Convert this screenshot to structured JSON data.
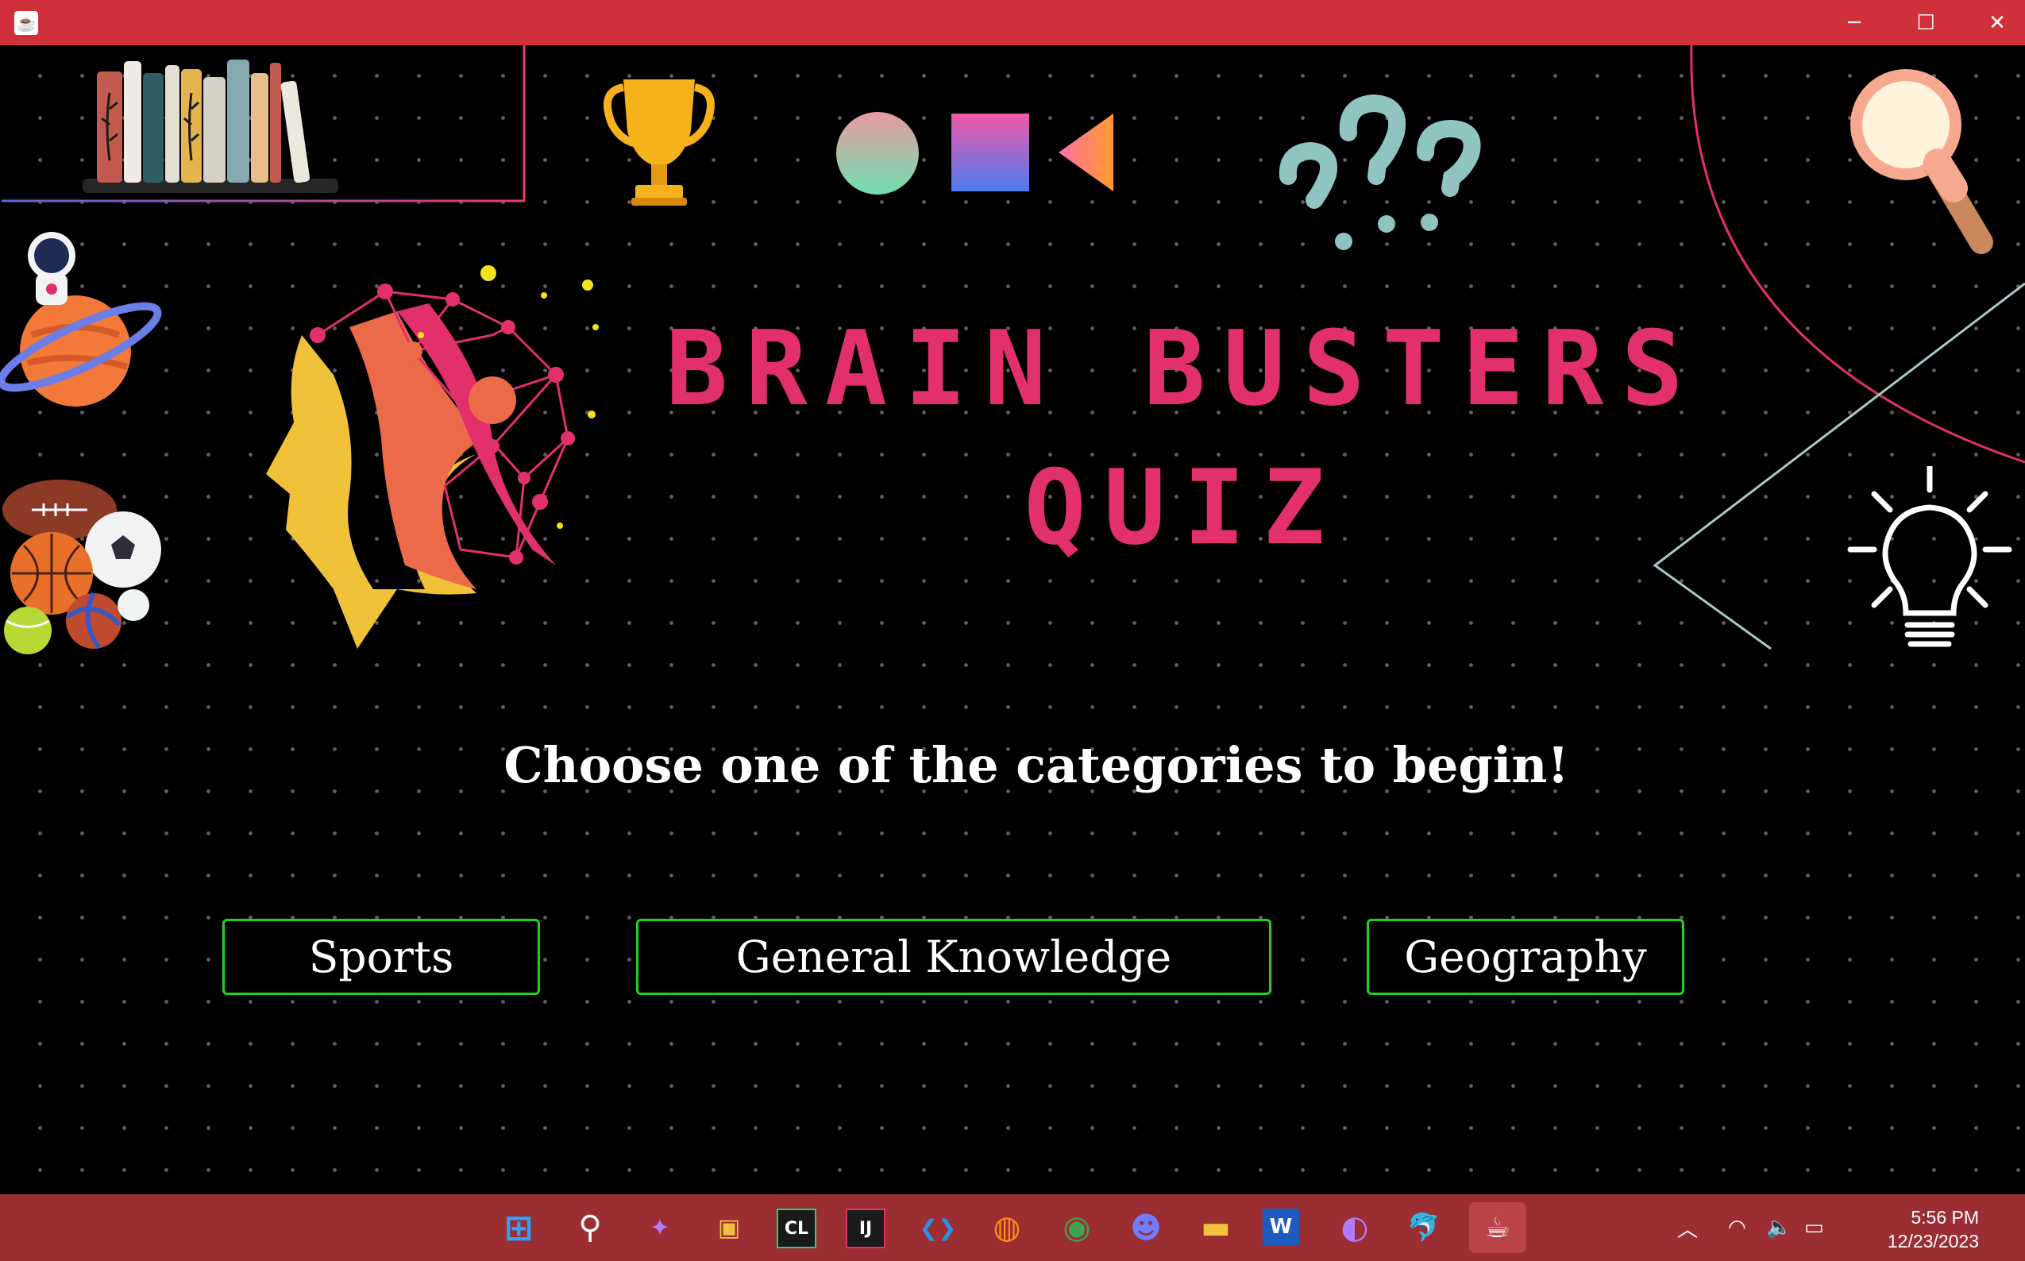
{
  "window": {
    "icon": "java-icon",
    "controls": {
      "minimize": "─",
      "maximize": "☐",
      "close": "✕"
    }
  },
  "title": {
    "line1": "BRAIN BUSTERS",
    "line2": "QUIZ"
  },
  "subtitle": "Choose one of the categories to begin!",
  "categories": {
    "sports": "Sports",
    "general": "General Knowledge",
    "geography": "Geography"
  },
  "decorations": [
    "books-icon",
    "trophy-icon",
    "shapes-icon",
    "question-marks-icon",
    "magnifier-icon",
    "astronaut-planet-icon",
    "sports-balls-icon",
    "brain-head-icon",
    "lightbulb-icon"
  ],
  "colors": {
    "titlebar": "#d0303a",
    "taskbar": "#9a2e33",
    "title": "#e2306b",
    "button_border": "#1fd11f",
    "background": "#000000"
  },
  "taskbar": {
    "apps": [
      {
        "name": "start",
        "glyph": "⊞"
      },
      {
        "name": "search",
        "glyph": "⚲"
      },
      {
        "name": "copilot",
        "glyph": "✦"
      },
      {
        "name": "store",
        "glyph": "▣"
      },
      {
        "name": "clion",
        "glyph": "CL"
      },
      {
        "name": "intellij",
        "glyph": "IJ"
      },
      {
        "name": "vscode",
        "glyph": "❮❯"
      },
      {
        "name": "firefox",
        "glyph": "◍"
      },
      {
        "name": "chrome",
        "glyph": "◉"
      },
      {
        "name": "discord",
        "glyph": "☻"
      },
      {
        "name": "file-explorer",
        "glyph": "▬"
      },
      {
        "name": "word",
        "glyph": "W"
      },
      {
        "name": "github",
        "glyph": "◐"
      },
      {
        "name": "mysql",
        "glyph": "🐬"
      },
      {
        "name": "java",
        "glyph": "☕"
      }
    ],
    "tray": {
      "chevron": "︿",
      "wifi": "◠",
      "volume": "🔈",
      "battery": "▭"
    },
    "clock": {
      "time": "5:56 PM",
      "date": "12/23/2023"
    }
  }
}
